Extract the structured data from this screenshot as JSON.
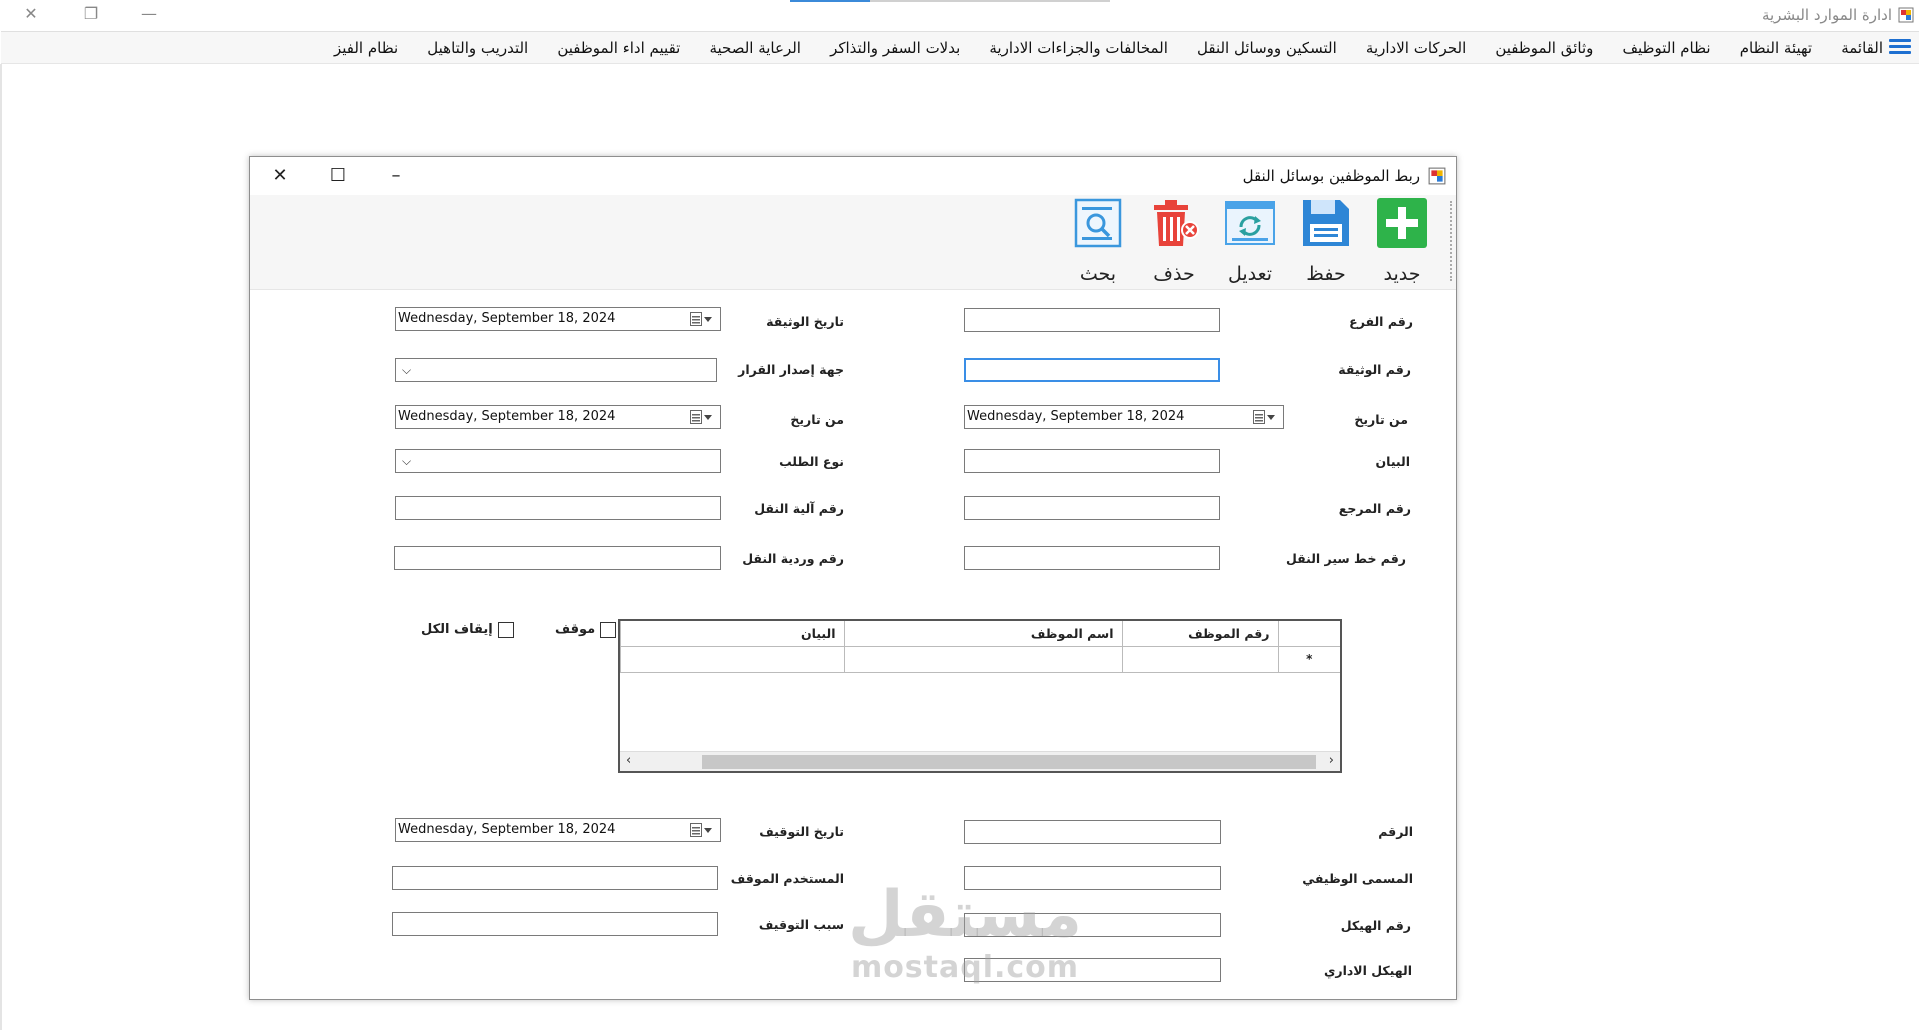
{
  "app": {
    "title": "ادارة الموارد البشرية"
  },
  "menu": {
    "items": [
      "القائمة",
      "تهيئة النظام",
      "نظام التوظيف",
      "وثائق الموظفين",
      "الحركات الادارية",
      "التسكين ووسائل النقل",
      "المخالفات والجزاءات الادارية",
      "بدلات السفر والتذاكر",
      "الرعاية الصحية",
      "تقييم اداء الموظفين",
      "التدريب والتاهيل",
      "نظام الفيز"
    ]
  },
  "child": {
    "title": "ربط الموظفين بوسائل النقل",
    "toolbar": {
      "new": "جديد",
      "save": "حفظ",
      "edit": "تعديل",
      "delete": "حذف",
      "search": "بحث"
    },
    "labels": {
      "branch_no": "رقم الفرع",
      "doc_date": "تاريخ الوثيقة",
      "doc_no": "رقم الوثيقة",
      "decision_source": "جهة إصدار القرار",
      "from_date_right": "من تاريخ",
      "from_date_left": "من تاريخ",
      "statement": "البيان",
      "request_type": "نوع الطلب",
      "reference_no": "رقم المرجع",
      "vehicle_no": "رقم آلية النقل",
      "route_no": "رقم خط سير النقل",
      "shift_no": "رقم وردية النقل",
      "stopped": "موقف",
      "stop_all": "إيقاف الكل",
      "number": "الرقم",
      "stop_date": "تاريخ التوقيف",
      "job_title": "المسمى الوظيفي",
      "stopping_user": "المستخدم الموقف",
      "structure_no": "رقم الهيكل",
      "stop_reason": "سبب التوقيف",
      "admin_structure": "الهيكل الاداري"
    },
    "dates": {
      "doc_date": "Wednesday, September 18, 2024",
      "from_date_left": "Wednesday, September 18, 2024",
      "from_date_right": "Wednesday, September 18, 2024",
      "stop_date": "Wednesday, September 18, 2024"
    },
    "grid": {
      "columns": [
        "رقم الموظف",
        "اسم الموظف",
        "البيان"
      ],
      "new_row_marker": "*"
    }
  },
  "watermark": {
    "ar": "مستقل",
    "en": "mostaql.com"
  }
}
